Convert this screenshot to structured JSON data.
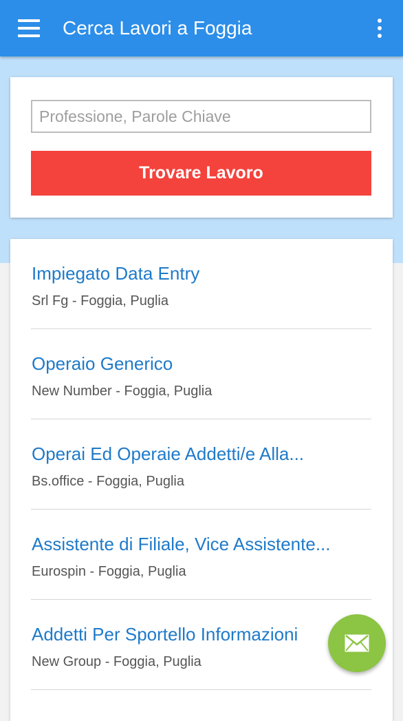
{
  "app_bar": {
    "title": "Cerca Lavori a Foggia",
    "menu_icon": "hamburger-menu-icon",
    "overflow_icon": "more-vertical-icon",
    "color": "#2c8ee8"
  },
  "search": {
    "placeholder": "Professione, Parole Chiave",
    "value": "",
    "button_label": "Trovare Lavoro",
    "button_color": "#f4433c"
  },
  "jobs": [
    {
      "title": "Impiegato Data Entry",
      "subtitle": "Srl Fg - Foggia, Puglia"
    },
    {
      "title": "Operaio Generico",
      "subtitle": "New Number - Foggia, Puglia"
    },
    {
      "title": "Operai Ed Operaie Addetti/e Alla...",
      "subtitle": "Bs.office - Foggia, Puglia"
    },
    {
      "title": "Assistente di Filiale, Vice Assistente...",
      "subtitle": "Eurospin - Foggia, Puglia"
    },
    {
      "title": "Addetti Per Sportello Informazioni",
      "subtitle": "New Group - Foggia, Puglia"
    }
  ],
  "fab": {
    "icon": "mail-icon",
    "color": "#8cc443"
  },
  "colors": {
    "job_title": "#1f7ac9",
    "hero_band": "#bfe0fb"
  }
}
